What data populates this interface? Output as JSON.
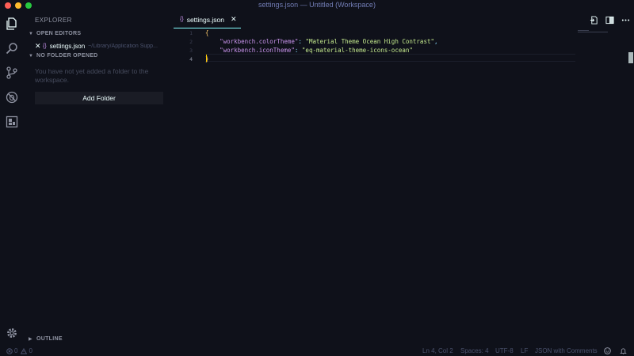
{
  "window": {
    "title": "settings.json — Untitled (Workspace)"
  },
  "sidebar": {
    "title": "EXPLORER",
    "open_editors": {
      "header": "OPEN EDITORS",
      "items": [
        {
          "close": "✕",
          "braces": "{}",
          "name": "settings.json",
          "path": "~/Library/Application Supp..."
        }
      ]
    },
    "no_folder": {
      "header": "NO FOLDER OPENED",
      "message": "You have not yet added a folder to the workspace.",
      "button": "Add Folder"
    },
    "outline": {
      "header": "OUTLINE"
    }
  },
  "tabs": [
    {
      "braces": "{}",
      "name": "settings.json",
      "close": "✕"
    }
  ],
  "editor": {
    "line_numbers": [
      "1",
      "2",
      "3",
      "4"
    ],
    "lines": [
      {
        "open": "{"
      },
      {
        "key": "\"workbench.colorTheme\"",
        "sep": ": ",
        "value": "\"Material Theme Ocean High Contrast\"",
        "end": ","
      },
      {
        "key": "\"workbench.iconTheme\"",
        "sep": ": ",
        "value": "\"eq-material-theme-icons-ocean\"",
        "end": ""
      },
      {
        "close": "}"
      }
    ]
  },
  "statusbar": {
    "errors": "0",
    "warnings": "0",
    "position": "Ln 4, Col 2",
    "spaces": "Spaces: 4",
    "encoding": "UTF-8",
    "eol": "LF",
    "language": "JSON with Comments"
  },
  "colors": {
    "background": "#0f111a",
    "accent": "#84ffff",
    "keyword": "#c792ea",
    "string": "#c3e88d",
    "punctuation": "#89ddff"
  }
}
